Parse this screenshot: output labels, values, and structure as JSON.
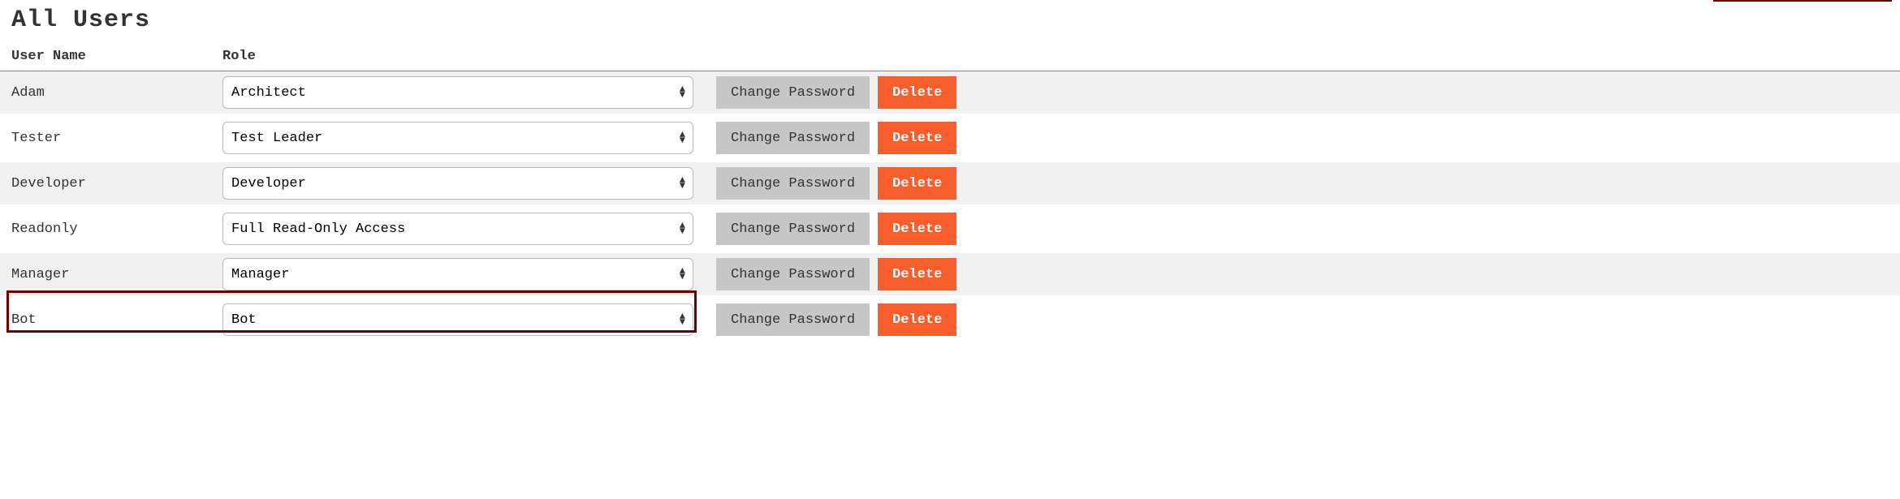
{
  "title": "All Users",
  "columns": {
    "username": "User Name",
    "role": "Role"
  },
  "buttons": {
    "change_password": "Change Password",
    "delete": "Delete"
  },
  "users": [
    {
      "username": "Adam",
      "role": "Architect"
    },
    {
      "username": "Tester",
      "role": "Test Leader"
    },
    {
      "username": "Developer",
      "role": "Developer"
    },
    {
      "username": "Readonly",
      "role": "Full Read-Only Access"
    },
    {
      "username": "Manager",
      "role": "Manager"
    },
    {
      "username": "Bot",
      "role": "Bot"
    }
  ]
}
